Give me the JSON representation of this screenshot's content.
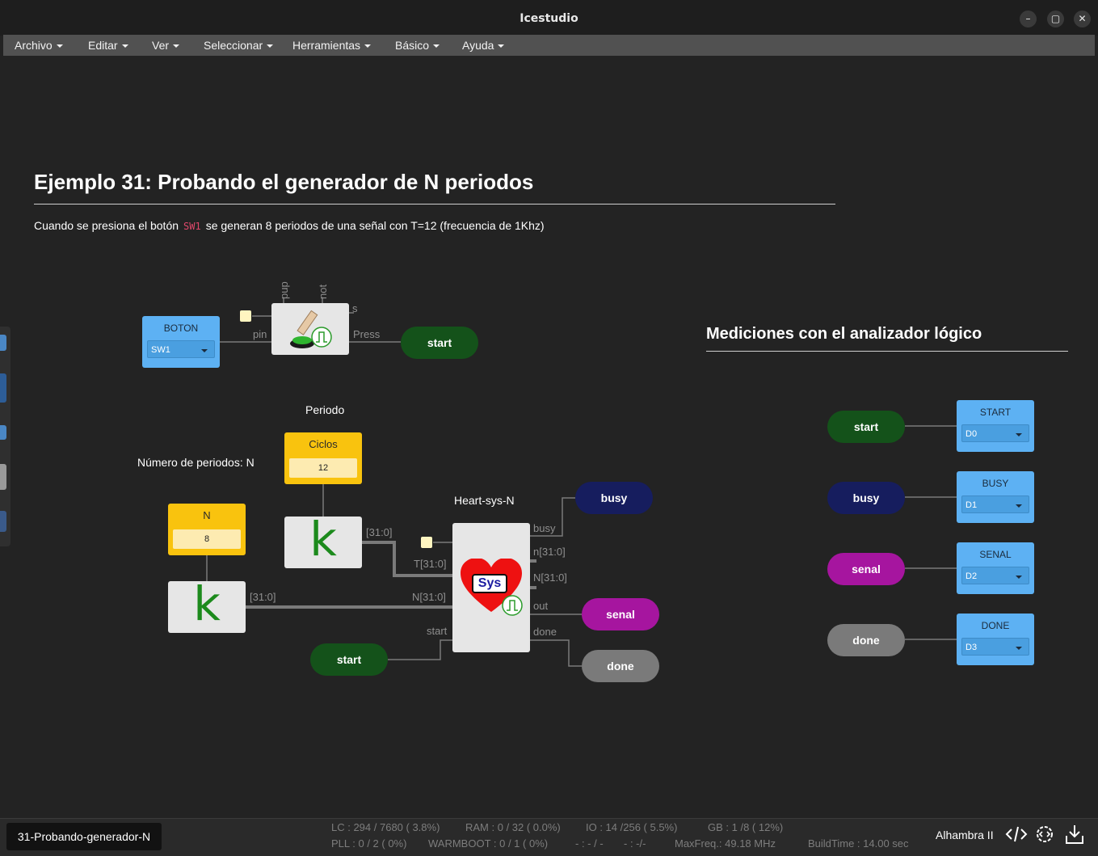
{
  "window": {
    "title": "Icestudio",
    "minimize_glyph": "–",
    "maximize_glyph": "▢",
    "close_glyph": "✕"
  },
  "menu": [
    "Archivo",
    "Editar",
    "Ver",
    "Seleccionar",
    "Herramientas",
    "Básico",
    "Ayuda"
  ],
  "doc": {
    "heading": "Ejemplo 31: Probando el generador de N periodos",
    "desc_before": "Cuando se presiona el botón",
    "desc_code": "SW1",
    "desc_after": "se generan 8 periodos de una señal con T=12 (frecuencia de 1Khz)",
    "measurements_title": "Mediciones con el analizador lógico"
  },
  "circuit": {
    "boton": {
      "title": "BOTON",
      "value": "SW1"
    },
    "button_ports": {
      "pup": "pup",
      "not": "not",
      "s": "s",
      "pin": "pin",
      "press": "Press"
    },
    "start_label": "start",
    "periodo_label": "Periodo",
    "n_periods_label": "Número de periodos: N",
    "ciclos": {
      "title": "Ciclos",
      "value": "12"
    },
    "n_const": {
      "title": "N",
      "value": "8"
    },
    "k_glyph": "k",
    "heart_label": "Heart-sys-N",
    "heart_text": "Sys",
    "bus_label": "[31:0]",
    "heart_ports": {
      "t_in": "T[31:0]",
      "n_in": "N[31:0]",
      "start_in": "start",
      "busy": "busy",
      "n_out_lower": "n[31:0]",
      "n_out_upper": "N[31:0]",
      "out": "out",
      "done": "done"
    },
    "outputs": {
      "busy": "busy",
      "senal": "senal",
      "done": "done"
    }
  },
  "analyzer": [
    {
      "tag": "start",
      "color": "#14521a",
      "title": "START",
      "pin": "D0"
    },
    {
      "tag": "busy",
      "color": "#161d5e",
      "title": "BUSY",
      "pin": "D1"
    },
    {
      "tag": "senal",
      "color": "#a6159f",
      "title": "SENAL",
      "pin": "D2"
    },
    {
      "tag": "done",
      "color": "#7a7a7a",
      "title": "DONE",
      "pin": "D3"
    }
  ],
  "status": {
    "file_tab": "31-Probando-generador-N",
    "lc": "LC : 294 / 7680 ( 3.8%)",
    "ram": "RAM : 0 / 32 ( 0.0%)",
    "io": "IO :  14 /256  ( 5.5%)",
    "gb": "GB :  1 /8  ( 12%)",
    "pll": "PLL : 0 / 2 ( 0%)",
    "warmboot": "WARMBOOT : 0 / 1 ( 0%)",
    "slash1": "- : - / -",
    "slash2": "- : -/-",
    "maxfreq": "MaxFreq.: 49.18 MHz",
    "buildtime": "BuildTime :  14.00 sec",
    "board": "Alhambra II"
  },
  "colors": {
    "start": "#14521a",
    "busy": "#161d5e",
    "senal": "#a6159f",
    "done": "#7a7a7a",
    "io_block": "#5db1f3",
    "const_block": "#f9c30e"
  }
}
